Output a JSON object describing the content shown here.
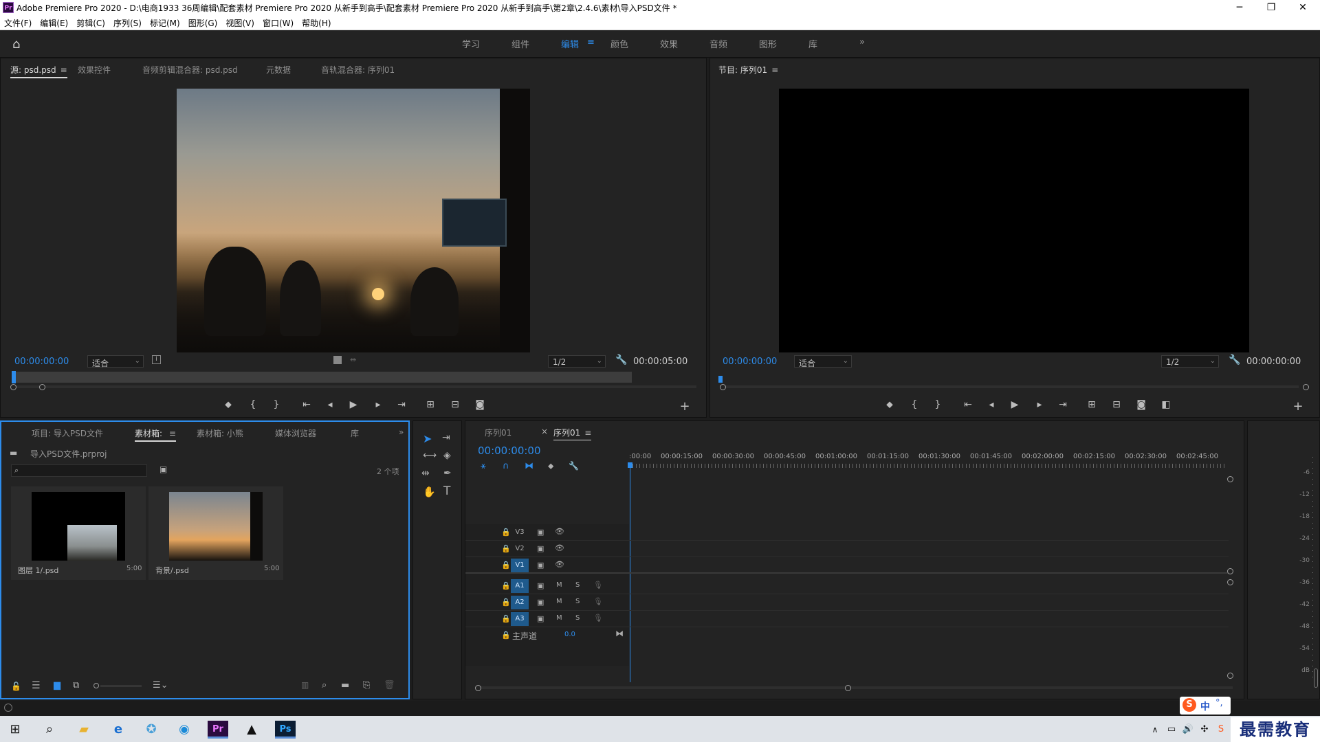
{
  "window": {
    "title": "Adobe Premiere Pro 2020 - D:\\电商1933 36周编辑\\配套素材 Premiere Pro 2020 从新手到高手\\配套素材 Premiere Pro 2020 从新手到高手\\第2章\\2.4.6\\素材\\导入PSD文件 *",
    "logo": "Pr"
  },
  "menu": [
    "文件(F)",
    "编辑(E)",
    "剪辑(C)",
    "序列(S)",
    "标记(M)",
    "图形(G)",
    "视图(V)",
    "窗口(W)",
    "帮助(H)"
  ],
  "workspaces": [
    "学习",
    "组件",
    "编辑",
    "颜色",
    "效果",
    "音频",
    "图形",
    "库"
  ],
  "active_workspace": "编辑",
  "source_panel": {
    "tabs": [
      "源: psd.psd",
      "效果控件",
      "音频剪辑混合器: psd.psd",
      "元数据",
      "音轨混合器: 序列01"
    ],
    "timecode_in": "00:00:00:00",
    "fit": "适合",
    "resolution": "1/2",
    "duration": "00:00:05:00"
  },
  "program_panel": {
    "tab": "节目: 序列01",
    "timecode_in": "00:00:00:00",
    "fit": "适合",
    "resolution": "1/2",
    "duration": "00:00:00:00"
  },
  "project_panel": {
    "tabs": [
      "项目: 导入PSD文件",
      "素材箱: ",
      "素材箱: 小熊",
      "媒体浏览器",
      "库"
    ],
    "project_file": "导入PSD文件.prproj",
    "item_count": "2 个项",
    "items": [
      {
        "name": "图层 1/.psd",
        "duration": "5:00"
      },
      {
        "name": "背景/.psd",
        "duration": "5:00"
      }
    ]
  },
  "timeline_panel": {
    "tabs": [
      "序列01",
      "序列01"
    ],
    "timecode": "00:00:00:00",
    "ruler": [
      ":00:00",
      "00:00:15:00",
      "00:00:30:00",
      "00:00:45:00",
      "00:01:00:00",
      "00:01:15:00",
      "00:01:30:00",
      "00:01:45:00",
      "00:02:00:00",
      "00:02:15:00",
      "00:02:30:00",
      "00:02:45:00"
    ],
    "video_tracks": [
      "V3",
      "V2",
      "V1"
    ],
    "audio_tracks": [
      "A1",
      "A2",
      "A3"
    ],
    "master_label": "主声道",
    "master_value": "0.0"
  },
  "audio_meter": {
    "ticks": [
      "-6",
      "-12",
      "-18",
      "-24",
      "-30",
      "-36",
      "-42",
      "-48",
      "-54",
      "dB"
    ]
  },
  "taskbar": {
    "ime": "中",
    "watermark": "最需教育"
  }
}
